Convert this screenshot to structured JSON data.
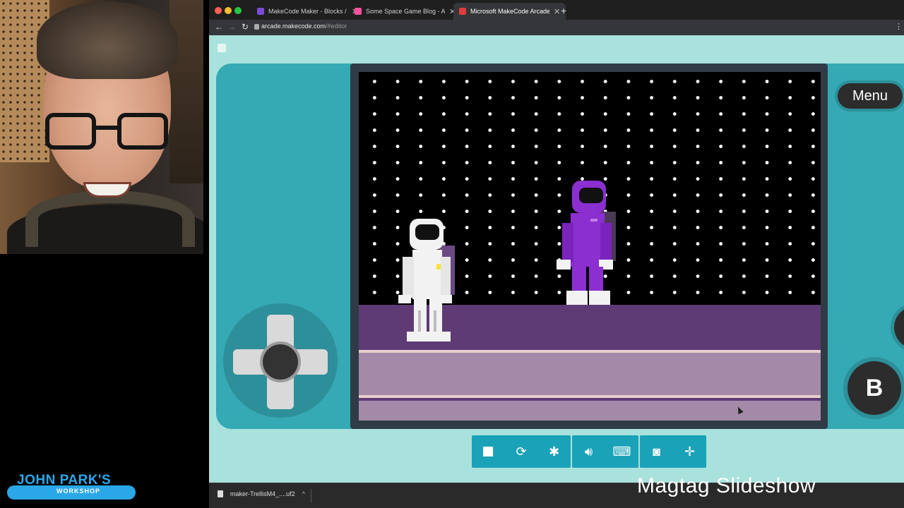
{
  "browser": {
    "tabs": [
      {
        "title": "MakeCode Maker - Blocks / Ja",
        "fav_color": "#7a4bd6"
      },
      {
        "title": "Some Space Game Blog - Arca",
        "fav_color": "#ff4fa0"
      },
      {
        "title": "Microsoft MakeCode Arcade",
        "fav_color": "#e03c3c",
        "active": true
      }
    ],
    "url_host": "arcade.makecode.com",
    "url_path": "/#editor",
    "download_file": "maker-TrellisM4_....uf2"
  },
  "simulator": {
    "menu_label": "Menu",
    "b_label": "B",
    "background_color": "#a9e2dc",
    "console_color": "#35a9b4",
    "toolbar_color": "#1aa2b8"
  },
  "toolbar": {
    "buttons": [
      {
        "icon": "stop-icon"
      },
      {
        "icon": "restart-icon"
      },
      {
        "icon": "debug-icon"
      },
      {
        "icon": "sound-icon"
      },
      {
        "icon": "keyboard-icon"
      },
      {
        "icon": "screenshot-icon"
      },
      {
        "icon": "fullscreen-icon"
      }
    ]
  },
  "overlay": {
    "brand_name": "JOHN PARK'S",
    "brand_sub": "WORKSHOP",
    "caption": "Magtag Slideshow"
  }
}
